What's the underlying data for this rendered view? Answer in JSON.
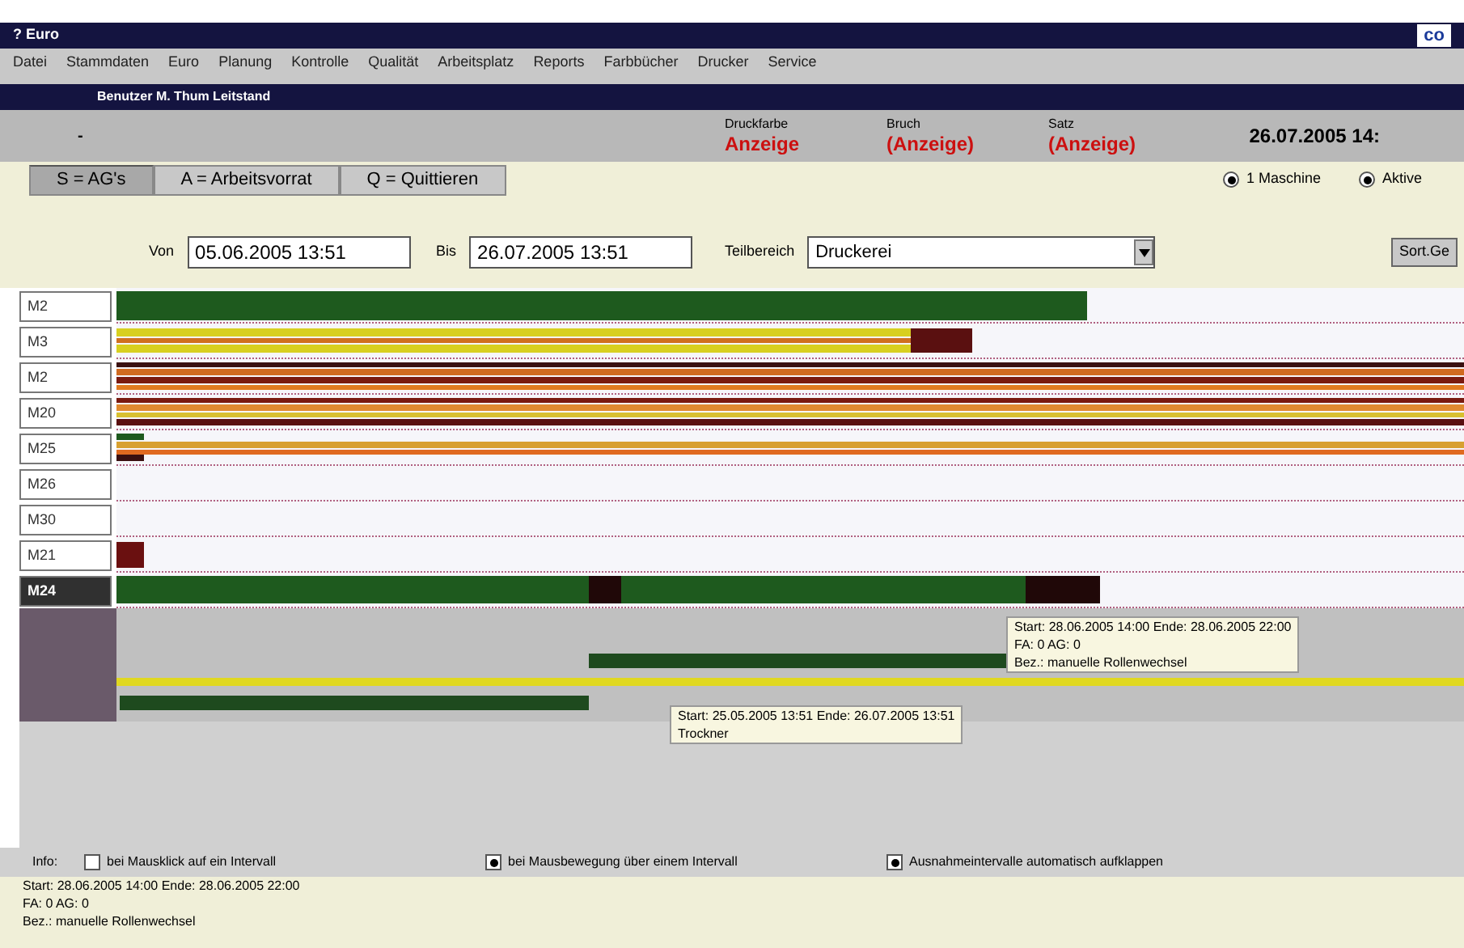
{
  "window": {
    "title": "? Euro",
    "logo": "co"
  },
  "menu": [
    "Datei",
    "Stammdaten",
    "Euro",
    "Planung",
    "Kontrolle",
    "Qualität",
    "Arbeitsplatz",
    "Reports",
    "Farbbücher",
    "Drucker",
    "Service"
  ],
  "subtitle": "Benutzer M. Thum Leitstand",
  "header": {
    "marker": "-",
    "fields": [
      {
        "label": "Druckfarbe",
        "value": "Anzeige"
      },
      {
        "label": "Bruch",
        "value": "(Anzeige)"
      },
      {
        "label": "Satz",
        "value": "(Anzeige)"
      }
    ],
    "datetime": "26.07.2005 14:"
  },
  "tabs": [
    {
      "label": "S = AG's",
      "selected": true
    },
    {
      "label": "A = Arbeitsvorrat",
      "selected": false
    },
    {
      "label": "Q = Quittieren",
      "selected": false
    }
  ],
  "options": [
    {
      "label": "1 Maschine",
      "checked": true
    },
    {
      "label": "Aktive",
      "checked": true
    }
  ],
  "filter": {
    "from_label": "Von",
    "from": "05.06.2005 13:51",
    "to_label": "Bis",
    "to": "26.07.2005 13:51",
    "area_label": "Teilbereich",
    "area": "Druckerei",
    "button": "Sort.Ge"
  },
  "machines": [
    {
      "name": "M2",
      "selected": false
    },
    {
      "name": "M3",
      "selected": false
    },
    {
      "name": "M2",
      "selected": false
    },
    {
      "name": "M20",
      "selected": false
    },
    {
      "name": "M25",
      "selected": false
    },
    {
      "name": "M26",
      "selected": false
    },
    {
      "name": "M30",
      "selected": false
    },
    {
      "name": "M21",
      "selected": false
    },
    {
      "name": "M24",
      "selected": true
    }
  ],
  "tooltips": [
    {
      "lines": [
        "Start: 28.06.2005 14:00 Ende: 28.06.2005 22:00",
        "FA: 0 AG: 0",
        "Bez.: manuelle Rollenwechsel"
      ]
    },
    {
      "lines": [
        "Start: 25.05.2005 13:51 Ende: 26.07.2005 13:51",
        "Trockner"
      ]
    }
  ],
  "info": {
    "label": "Info:",
    "options": [
      {
        "label": "bei Mausklick auf ein Intervall",
        "checked": false
      },
      {
        "label": "bei Mausbewegung über einem Intervall",
        "checked": true
      },
      {
        "label": "Ausnahmeintervalle automatisch aufklappen",
        "checked": true
      }
    ],
    "lines": [
      "Start: 28.06.2005 14:00 Ende: 28.06.2005 22:00",
      "FA: 0 AG: 0",
      "Bez.: manuelle Rollenwechsel"
    ]
  }
}
